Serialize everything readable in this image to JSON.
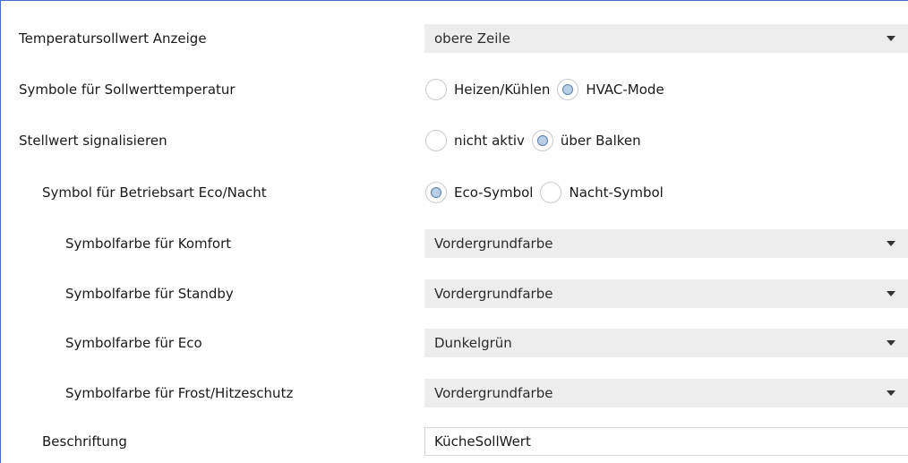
{
  "rows": {
    "temp_display": {
      "label": "Temperatursollwert Anzeige",
      "value": "obere Zeile"
    },
    "setpoint_symbols": {
      "label": "Symbole für Sollwerttemperatur",
      "options": [
        "Heizen/Kühlen",
        "HVAC-Mode"
      ],
      "selected": "HVAC-Mode"
    },
    "signal_value": {
      "label": "Stellwert signalisieren",
      "options": [
        "nicht aktiv",
        "über Balken"
      ],
      "selected": "über Balken"
    },
    "eco_night_symbol": {
      "label": "Symbol für Betriebsart Eco/Nacht",
      "options": [
        "Eco-Symbol",
        "Nacht-Symbol"
      ],
      "selected": "Eco-Symbol"
    },
    "color_comfort": {
      "label": "Symbolfarbe für Komfort",
      "value": "Vordergrundfarbe"
    },
    "color_standby": {
      "label": "Symbolfarbe für Standby",
      "value": "Vordergrundfarbe"
    },
    "color_eco": {
      "label": "Symbolfarbe für Eco",
      "value": "Dunkelgrün"
    },
    "color_frost": {
      "label": "Symbolfarbe für Frost/Hitzeschutz",
      "value": "Vordergrundfarbe"
    },
    "caption": {
      "label": "Beschriftung",
      "value": "KücheSollWert"
    }
  },
  "colors": {
    "frame_border": "#4472c4",
    "select_bg": "#ededed",
    "radio_checked_fill": "#b8cfe6"
  }
}
